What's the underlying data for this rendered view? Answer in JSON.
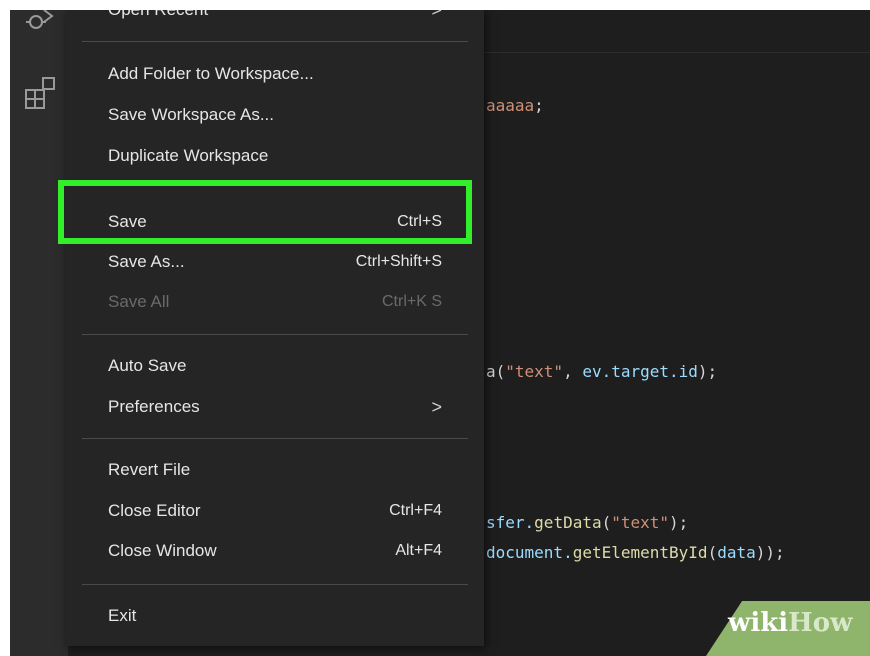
{
  "menu": {
    "open_recent": {
      "label": "Open Recent"
    },
    "add_folder": {
      "label": "Add Folder to Workspace..."
    },
    "save_workspace_as": {
      "label": "Save Workspace As..."
    },
    "duplicate_workspace": {
      "label": "Duplicate Workspace"
    },
    "save": {
      "label": "Save",
      "shortcut": "Ctrl+S"
    },
    "save_as": {
      "label": "Save As...",
      "shortcut": "Ctrl+Shift+S"
    },
    "save_all": {
      "label": "Save All",
      "shortcut": "Ctrl+K S"
    },
    "auto_save": {
      "label": "Auto Save"
    },
    "preferences": {
      "label": "Preferences"
    },
    "revert_file": {
      "label": "Revert File"
    },
    "close_editor": {
      "label": "Close Editor",
      "shortcut": "Ctrl+F4"
    },
    "close_window": {
      "label": "Close Window",
      "shortcut": "Alt+F4"
    },
    "exit": {
      "label": "Exit"
    },
    "submenu_glyph": ">"
  },
  "code": {
    "line1": {
      "str": "aaaaa",
      "punc": ";"
    },
    "line2": {
      "p1": "a(",
      "s1": "\"text\"",
      "p2": ", ",
      "v1": "ev.target.id",
      "p3": ");"
    },
    "line3": {
      "v1": "sfer.",
      "f1": "getData",
      "p1": "(",
      "s1": "\"text\"",
      "p2": ");"
    },
    "line4": {
      "v1": "document.",
      "f1": "getElementById",
      "p1": "(",
      "v2": "data",
      "p2": "));"
    }
  },
  "watermark": {
    "part1": "wiki",
    "part2": "How"
  },
  "icons": {
    "activity_bar": [
      "debug-icon",
      "extensions-icon"
    ],
    "submenu": "chevron-right-icon"
  },
  "colors": {
    "highlight": "#33ee2a",
    "menu_bg": "#252526",
    "editor_bg": "#1e1e1e"
  }
}
